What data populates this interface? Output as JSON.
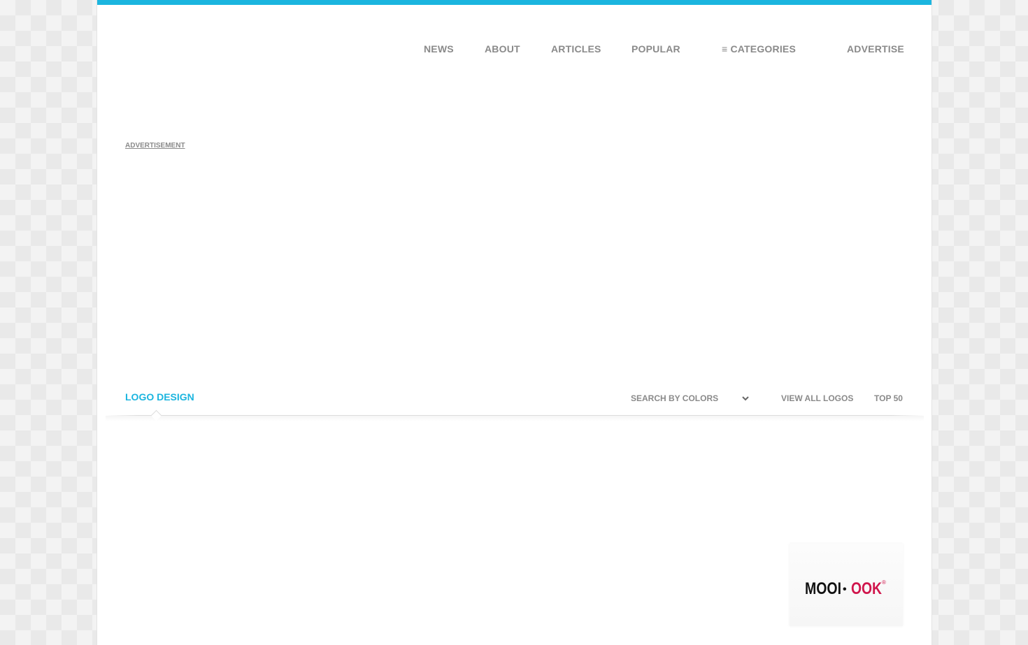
{
  "nav": {
    "news": "NEWS",
    "about": "ABOUT",
    "articles": "ARTICLES",
    "popular": "POPULAR",
    "categories": "≡ CATEGORIES",
    "advertise": "ADVERTISE"
  },
  "ad_label": "ADVERTISEMENT",
  "section": {
    "title": "LOGO DESIGN",
    "color_filter": {
      "selected": "SEARCH BY COLORS"
    },
    "view_all": "VIEW ALL LOGOS",
    "top50": "TOP 50"
  },
  "logo_tile": {
    "word_left": "MOOI",
    "separator": "•",
    "word_right": "OOK",
    "mark": "®"
  },
  "colors": {
    "accent": "#1bb5df",
    "nav_text": "#8a8a8a",
    "logo_black": "#111111",
    "logo_red": "#d0164c"
  },
  "icons": {
    "categories": "hamburger-icon",
    "select": "chevron-down-icon"
  }
}
